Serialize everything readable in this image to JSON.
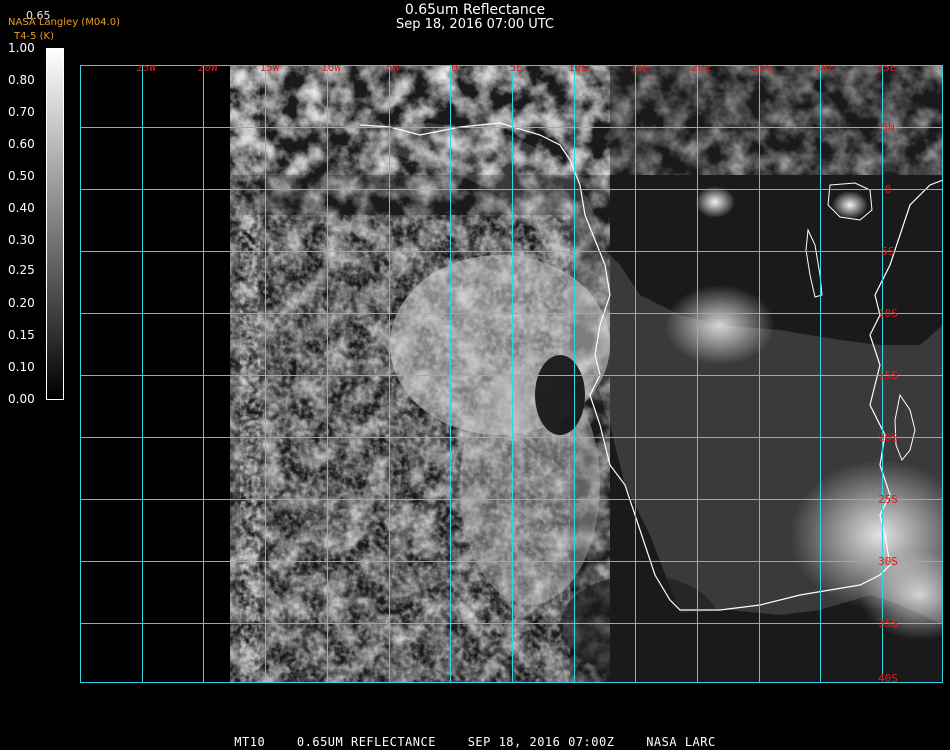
{
  "header": {
    "title": "0.65um Reflectance",
    "subtitle": "Sep 18, 2016 07:00 UTC",
    "credit_value": "0.65",
    "credit_line1": "NASA Langley (M04.0)",
    "credit_line2": "T4-5 (K)"
  },
  "colorbar": {
    "labels": [
      "1.00",
      "0.80",
      "0.70",
      "0.60",
      "0.50",
      "0.40",
      "0.30",
      "0.25",
      "0.20",
      "0.15",
      "0.10",
      "0.00"
    ]
  },
  "map": {
    "lon_labels": [
      "25W",
      "20W",
      "15W",
      "10W",
      "5W",
      "0",
      "5E",
      "10E",
      "15E",
      "20E",
      "25E",
      "30E",
      "35E"
    ],
    "lat_labels": [
      "5N",
      "0",
      "5S",
      "10S",
      "15S",
      "20S",
      "25S",
      "30S",
      "35S",
      "40S"
    ],
    "grid_color": "#33d6e0",
    "label_color": "#d42020",
    "coast_color": "#ffffff"
  },
  "footer": {
    "product": "MT10",
    "band": "0.65UM REFLECTANCE",
    "datetime": "SEP 18, 2016 07:00Z",
    "source": "NASA LARC"
  }
}
